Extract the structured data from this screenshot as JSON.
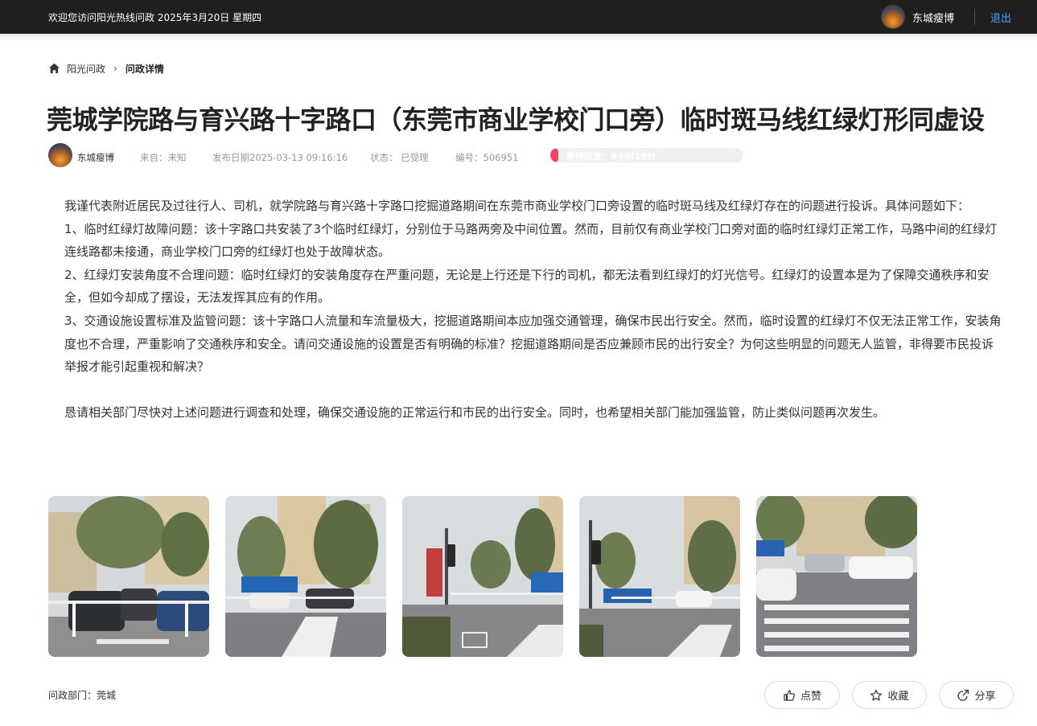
{
  "header": {
    "welcome": "欢迎您访问阳光热线问政 2025年3月20日 星期四",
    "user_name": "东城瘦博",
    "logout": "退出",
    "accent_color": "#4a9fff"
  },
  "breadcrumb": {
    "home_icon": "home-icon",
    "home_label": "阳光问政",
    "separator": "›",
    "current": "问政详情"
  },
  "article": {
    "title": "莞城学院路与育兴路十字路口（东莞市商业学校门口旁）临时斑马线红绿灯形同虚设",
    "author": "东城瘦博",
    "source": "来自：未知",
    "date": "发布日期2025-03-13 09:16:16",
    "status": "状态：  已受理",
    "number": "编号：506951",
    "wait_label": "等待回复：8小时19分",
    "wait_progress_fraction": 0.02,
    "progress_color": "#f0446a",
    "paragraphs": [
      "我谨代表附近居民及过往行人、司机，就学院路与育兴路十字路口挖掘道路期间在东莞市商业学校门口旁设置的临时斑马线及红绿灯存在的问题进行投诉。具体问题如下：",
      "1、临时红绿灯故障问题：该十字路口共安装了3个临时红绿灯，分别位于马路两旁及中间位置。然而，目前仅有商业学校门口旁对面的临时红绿灯正常工作，马路中间的红绿灯连线路都未接通，商业学校门口旁的红绿灯也处于故障状态。",
      "2、红绿灯安装角度不合理问题：临时红绿灯的安装角度存在严重问题，无论是上行还是下行的司机，都无法看到红绿灯的灯光信号。红绿灯的设置本是为了保障交通秩序和安全，但如今却成了摆设，无法发挥其应有的作用。",
      "3、交通设施设置标准及监管问题：该十字路口人流量和车流量极大，挖掘道路期间本应加强交通管理，确保市民出行安全。然而，临时设置的红绿灯不仅无法正常工作，安装角度也不合理，严重影响了交通秩序和安全。请问交通设施的设置是否有明确的标准？挖掘道路期间是否应兼顾市民的出行安全？为何这些明显的问题无人监管，非得要市民投诉举报才能引起重视和解决？",
      "恳请相关部门尽快对上述问题进行调查和处理，确保交通设施的正常运行和市民的出行安全。同时，也希望相关部门能加强监管，防止类似问题再次发生。"
    ],
    "department": "问政部门：莞城"
  },
  "actions": {
    "like_label": "点赞",
    "like_icon": "thumbs-up-icon",
    "favorite_label": "收藏",
    "favorite_icon": "star-icon",
    "share_label": "分享",
    "share_icon": "share-icon"
  }
}
